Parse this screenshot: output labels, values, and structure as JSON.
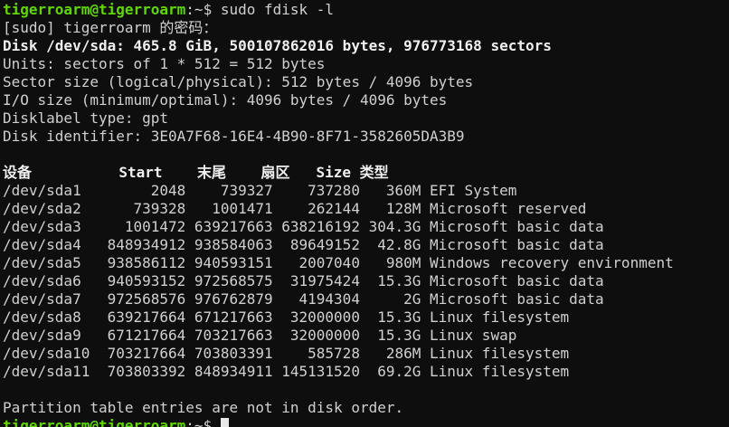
{
  "prompt": {
    "user_host": "tigerroarm@tigerroarm",
    "path": ":~$",
    "command": " sudo fdisk -l"
  },
  "lines": {
    "sudo_prompt": "[sudo] tigerroarm 的密码：",
    "disk": "Disk /dev/sda: 465.8 GiB, 500107862016 bytes, 976773168 sectors",
    "units": "Units: sectors of 1 * 512 = 512 bytes",
    "sector_size": "Sector size (logical/physical): 512 bytes / 4096 bytes",
    "io_size": "I/O size (minimum/optimal): 4096 bytes / 4096 bytes",
    "disklabel": "Disklabel type: gpt",
    "identifier": "Disk identifier: 3E0A7F68-16E4-4B90-8F71-3582605DA3B9",
    "footer": "Partition table entries are not in disk order."
  },
  "table": {
    "header": "设备          Start    末尾    扇区   Size 类型",
    "rows": [
      "/dev/sda1        2048    739327    737280   360M EFI System",
      "/dev/sda2      739328   1001471    262144   128M Microsoft reserved",
      "/dev/sda3     1001472 639217663 638216192 304.3G Microsoft basic data",
      "/dev/sda4   848934912 938584063  89649152  42.8G Microsoft basic data",
      "/dev/sda5   938586112 940593151   2007040   980M Windows recovery environment",
      "/dev/sda6   940593152 972568575  31975424  15.3G Microsoft basic data",
      "/dev/sda7   972568576 976762879   4194304     2G Microsoft basic data",
      "/dev/sda8   639217664 671217663  32000000  15.3G Linux filesystem",
      "/dev/sda9   671217664 703217663  32000000  15.3G Linux swap",
      "/dev/sda10  703217664 703803391    585728   286M Linux filesystem",
      "/dev/sda11  703803392 848934911 145131520  69.2G Linux filesystem"
    ]
  },
  "colors": {
    "background": "#0e0e0e",
    "text": "#d0d0d0",
    "prompt_green": "#5fd700"
  }
}
